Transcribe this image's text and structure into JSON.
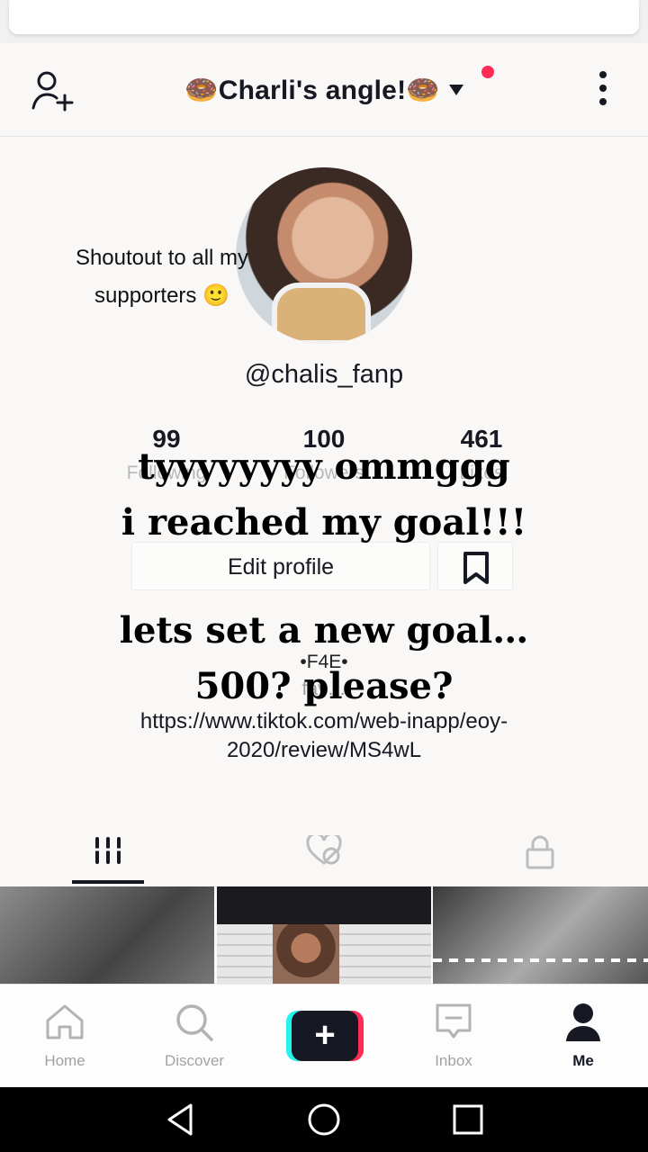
{
  "header": {
    "title": "🍩Charli's angle!🍩",
    "add_user_icon": "add-user-icon",
    "dropdown_icon": "chevron-down-icon",
    "more_icon": "more-vertical-icon",
    "notification_color": "#fe2c55"
  },
  "profile": {
    "shoutout": "Shoutout to all my supporters 🙂",
    "username": "@chalis_fanp",
    "stats": [
      {
        "value": "99",
        "label": "Following"
      },
      {
        "value": "100",
        "label": "Followers"
      },
      {
        "value": "461",
        "label": "Likes"
      }
    ],
    "edit_button": "Edit profile",
    "bookmark_icon": "bookmark-icon",
    "bio_code": "•F4E•",
    "bio_sub": "fav…",
    "bio_link": "https://www.tiktok.com/web-inapp/eoy-2020/review/MS4wL"
  },
  "overlay": {
    "line1": "tyyyyyyyy ommggg",
    "line2": "i reached my goal!!!",
    "line3": "lets set a new goal…",
    "line4": "500? please?"
  },
  "tabs": [
    {
      "icon": "videos-grid-icon",
      "active": true
    },
    {
      "icon": "liked-hidden-icon",
      "active": false
    },
    {
      "icon": "lock-icon",
      "active": false
    }
  ],
  "videos": [
    {
      "thumb": "video-thumbnail-1"
    },
    {
      "thumb": "video-thumbnail-2"
    },
    {
      "thumb": "video-thumbnail-3"
    }
  ],
  "bottom_nav": [
    {
      "label": "Home",
      "icon": "home-icon"
    },
    {
      "label": "Discover",
      "icon": "search-icon"
    },
    {
      "label": "",
      "icon": "plus-icon"
    },
    {
      "label": "Inbox",
      "icon": "inbox-icon"
    },
    {
      "label": "Me",
      "icon": "profile-icon",
      "active": true
    }
  ],
  "colors": {
    "accent_red": "#fe2c55",
    "accent_cyan": "#25f4ee",
    "text_dark": "#161823",
    "text_muted": "#a2a2a2"
  }
}
